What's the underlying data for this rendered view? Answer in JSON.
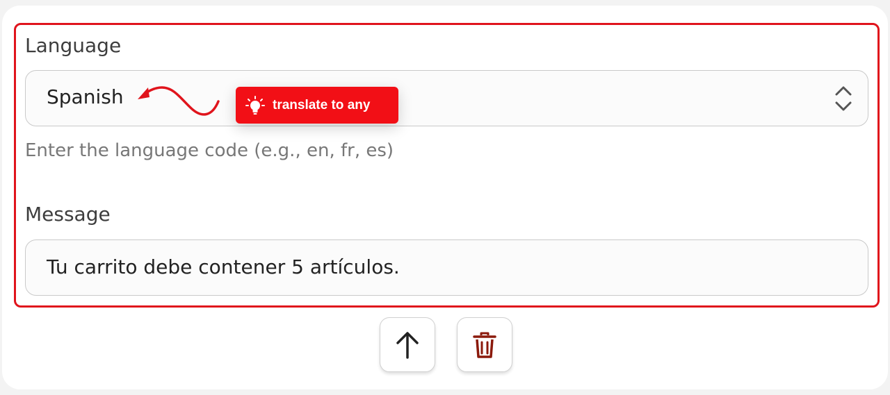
{
  "language_field": {
    "label": "Language",
    "selected_value": "Spanish",
    "help_text": "Enter the language code (e.g., en, fr, es)"
  },
  "message_field": {
    "label": "Message",
    "value": "Tu carrito debe contener 5 artículos."
  },
  "tooltip": {
    "text": "translate to any",
    "icon": "lightbulb-icon"
  },
  "actions": {
    "move_up_icon": "arrow-up-icon",
    "delete_icon": "trash-icon"
  },
  "colors": {
    "highlight": "#e0141c",
    "tooltip_bg": "#f20f16",
    "delete_icon": "#8b1a0c"
  }
}
